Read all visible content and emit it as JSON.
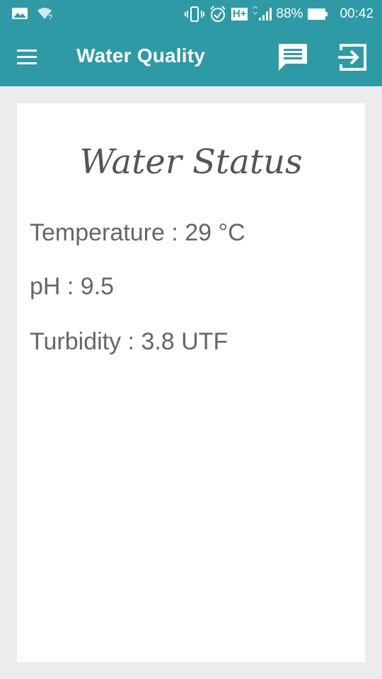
{
  "status_bar": {
    "battery": "88%",
    "time": "00:42",
    "network": "H+",
    "left_icons": [
      "image-icon",
      "wifi-question-icon"
    ],
    "right_icons": [
      "vibrate-icon",
      "alarm-icon",
      "network-type-icon",
      "signal-icon",
      "battery-icon"
    ]
  },
  "app_bar": {
    "title": "Water Quality",
    "icons": [
      "menu-icon",
      "chat-icon",
      "exit-icon"
    ]
  },
  "card": {
    "title": "Water Status",
    "readings": [
      {
        "text": "Temperature : 29 °C"
      },
      {
        "text": "pH : 9.5"
      },
      {
        "text": "Turbidity : 3.8 UTF"
      }
    ]
  },
  "colors": {
    "primary": "#2e9aa6",
    "background": "#ececec",
    "card": "#ffffff",
    "text": "#666666"
  }
}
